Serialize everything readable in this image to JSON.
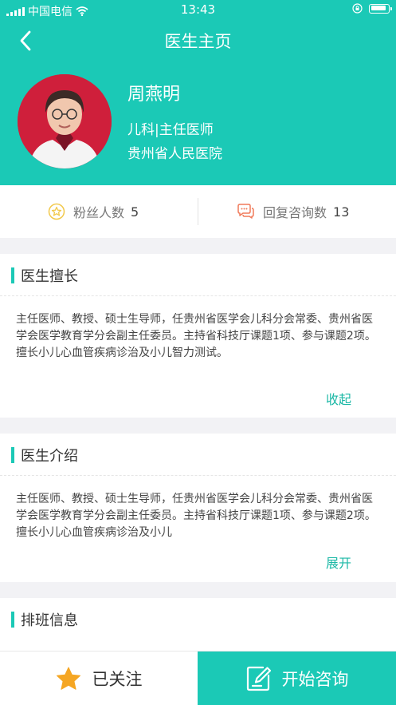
{
  "status_bar": {
    "carrier": "中国电信",
    "time": "13:43"
  },
  "nav": {
    "title": "医生主页"
  },
  "doctor": {
    "name": "周燕明",
    "dept_title": "儿科|主任医师",
    "hospital": "贵州省人民医院"
  },
  "stats": {
    "fans_label": "粉丝人数",
    "fans_value": "5",
    "replies_label": "回复咨询数",
    "replies_value": "13"
  },
  "expertise": {
    "title": "医生擅长",
    "text": "主任医师、教授、硕士生导师，任贵州省医学会儿科分会常委、贵州省医学会医学教育学分会副主任委员。主持省科技厅课题1项、参与课题2项。擅长小儿心血管疾病诊治及小儿智力测试。",
    "toggle": "收起"
  },
  "intro": {
    "title": "医生介绍",
    "text": "主任医师、教授、硕士生导师，任贵州省医学会儿科分会常委、贵州省医学会医学教育学分会副主任委员。主持省科技厅课题1项、参与课题2项。擅长小儿心血管疾病诊治及小儿",
    "toggle": "展开"
  },
  "schedule": {
    "title": "排班信息"
  },
  "bottom": {
    "follow_label": "已关注",
    "consult_label": "开始咨询"
  },
  "colors": {
    "accent": "#1bc9b6",
    "star": "#f5a623",
    "reply_icon": "#f07a5a"
  }
}
